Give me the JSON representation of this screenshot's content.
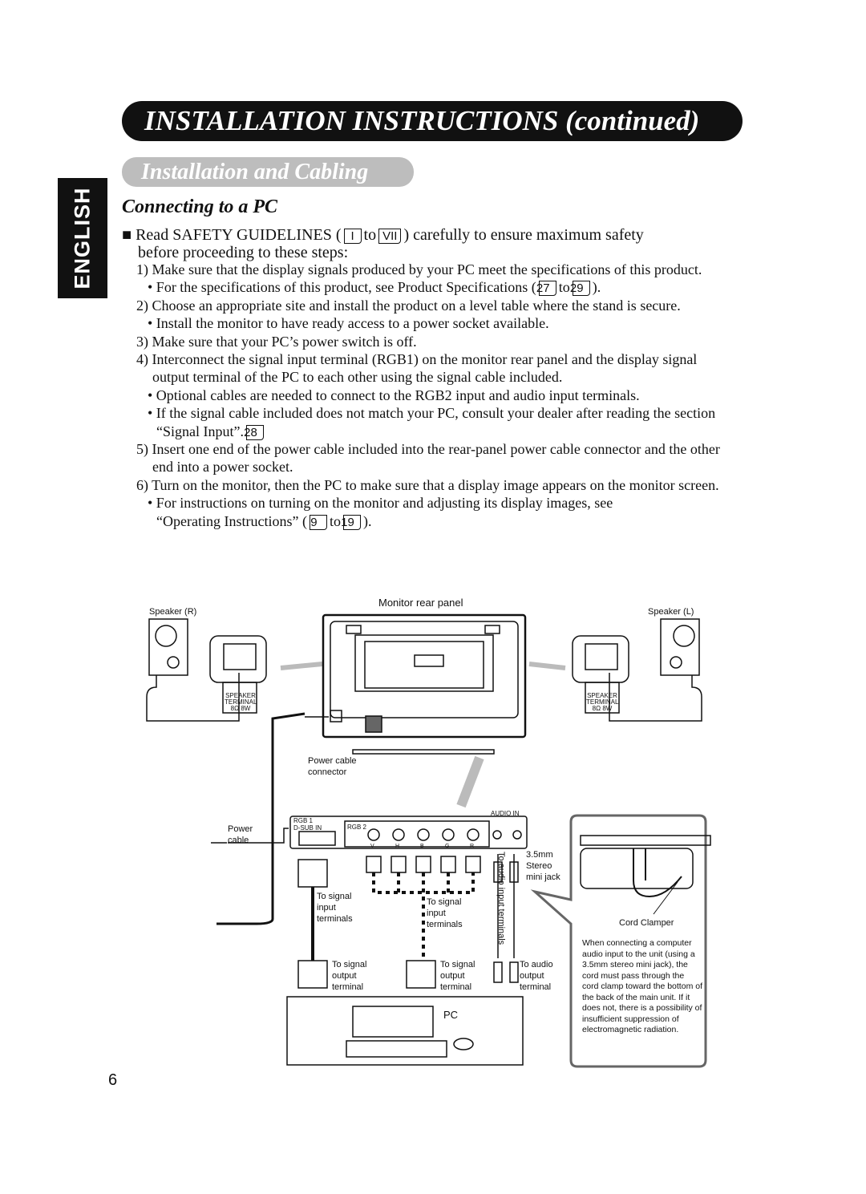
{
  "header": {
    "title": "INSTALLATION INSTRUCTIONS (continued)",
    "subtitle": "Installation and Cabling",
    "language_tab": "ENGLISH"
  },
  "section": {
    "title": "Connecting to a PC"
  },
  "intro": {
    "bullet": "■",
    "text_a": "Read SAFETY GUIDELINES (",
    "ref_a": "I",
    "to": "to",
    "ref_b": "VII",
    "text_b": ") carefully to ensure maximum safety",
    "text_c": "before proceeding to these steps:"
  },
  "steps": [
    {
      "text": "1) Make sure that the display signals produced by your PC meet the specifications of this product."
    },
    {
      "text": "• For the specifications of this product, see Product Specifications (",
      "ref_a": "27",
      "to": "to",
      "ref_b": "29",
      "end": ")."
    },
    {
      "text": "2) Choose an appropriate site and install the product on a level table where the stand is secure."
    },
    {
      "text": "• Install the monitor to have ready access to a power socket available."
    },
    {
      "text": "3) Make sure that your PC’s power switch is off."
    },
    {
      "text": "4) Interconnect the signal input terminal (RGB1) on the monitor rear panel and the display signal output terminal of the PC to each other using the signal cable included."
    },
    {
      "text": "• Optional cables are needed to connect to the RGB2 input and audio input terminals."
    },
    {
      "text": "• If the signal cable included does not match your PC, consult your dealer after reading the section “Signal Input”.",
      "ref_a": "28"
    },
    {
      "text": "5) Insert one end of the power cable included into the rear-panel power cable connector and the other end into a power socket."
    },
    {
      "text": "6) Turn on the monitor, then the PC to make sure that a display image appears on the monitor screen."
    },
    {
      "text": "• For instructions on turning on the monitor and adjusting its display images, see “Operating Instructions” (",
      "ref_a": "9",
      "to": "to",
      "ref_b": "19",
      "end": ")."
    }
  ],
  "diagram": {
    "speaker_r": "Speaker (R)",
    "speaker_l": "Speaker (L)",
    "monitor_rear_panel": "Monitor rear panel",
    "speaker_terminal": [
      "SPEAKER",
      "TERMINAL",
      "8Ω 8W"
    ],
    "power_cable_connector": "Power cable connector",
    "power_cable": "Power cable",
    "rgb1": "RGB 1",
    "dsub_in": "D-SUB IN",
    "rgb2": "RGB 2",
    "audio_in": "AUDIO IN",
    "bnc": [
      "V",
      "H",
      "B",
      "G",
      "R"
    ],
    "to_signal_input_1": "To signal input terminals",
    "to_signal_input_2": "To signal input terminals",
    "to_audio_input": "To audio input terminals",
    "stereo_jack": "3.5mm Stereo mini jack",
    "to_signal_output_1": "To signal output terminal",
    "to_signal_output_2": "To signal output terminal",
    "to_audio_output": "To audio output terminal",
    "pc": "PC",
    "cord_clamper": "Cord Clamper",
    "note": "When connecting a computer audio input to the unit (using a 3.5mm stereo mini jack), the cord must pass through the cord clamp toward the bottom of the back of the main unit. If it does not, there is a possibility of insufficient suppression of electromagnetic radiation."
  },
  "page_number": "6"
}
